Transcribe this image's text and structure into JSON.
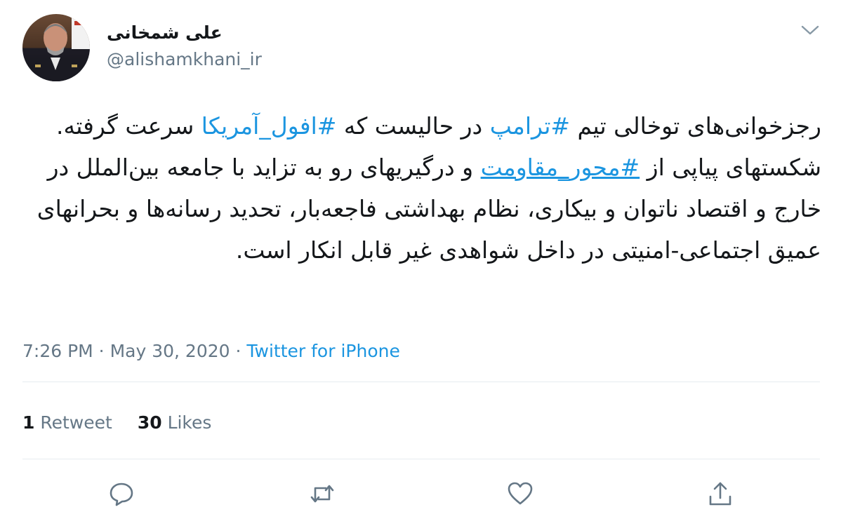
{
  "author": {
    "display_name": "علی شمخانی",
    "handle": "@alishamkhani_ir"
  },
  "tweet": {
    "line1_part1": "رجزخوانی‌های توخالی تیم ",
    "hashtag1": "#ترامپ",
    "line1_part2": " در حالیست که ",
    "hashtag2": "#افول_آمریکا",
    "part3": " سرعت گرفته. شکستهای پیاپی از ",
    "hashtag3": "#محور_مقاومت",
    "part4": " و درگیریهای رو به تزاید با جامعه بین‌الملل در خارج و اقتصاد ناتوان و بیکاری، نظام بهداشتی فاجعه‌بار، تحدید رسانه‌ها و بحرانهای عمیق اجتماعی-امنیتی در داخل شواهدی غیر قابل انکار است."
  },
  "meta": {
    "time": "7:26 PM",
    "sep1": " · ",
    "date": "May 30, 2020",
    "sep2": " · ",
    "source": "Twitter for iPhone"
  },
  "stats": {
    "retweet_count": "1",
    "retweet_label": "Retweet",
    "like_count": "30",
    "like_label": "Likes"
  },
  "icons": {
    "reply": "reply-icon",
    "retweet": "retweet-icon",
    "like": "heart-icon",
    "share": "share-icon",
    "more": "chevron-down-icon"
  },
  "colors": {
    "link": "#1b95e0",
    "secondary": "#657786",
    "text": "#14171a",
    "divider": "#e6ecf0"
  }
}
